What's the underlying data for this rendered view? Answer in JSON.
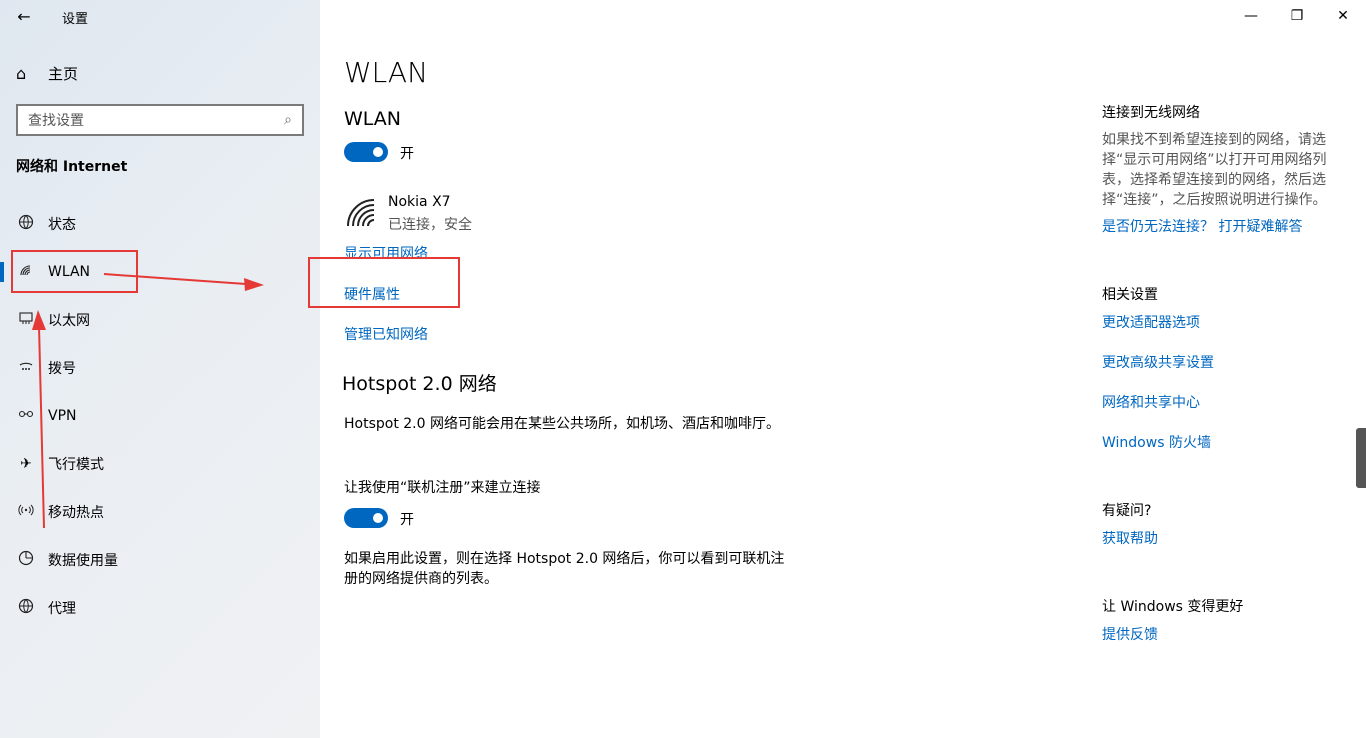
{
  "window": {
    "title": "设置",
    "back_glyph": "←",
    "minimize_glyph": "—",
    "restore_glyph": "❐",
    "close_glyph": "✕"
  },
  "sidebar": {
    "home_label": "主页",
    "search_placeholder": "查找设置",
    "section_title": "网络和 Internet",
    "items": [
      {
        "label": "状态",
        "icon": "globe-status-icon"
      },
      {
        "label": "WLAN",
        "icon": "wifi-icon"
      },
      {
        "label": "以太网",
        "icon": "ethernet-icon"
      },
      {
        "label": "拨号",
        "icon": "dialup-icon"
      },
      {
        "label": "VPN",
        "icon": "vpn-icon"
      },
      {
        "label": "飞行模式",
        "icon": "airplane-icon"
      },
      {
        "label": "移动热点",
        "icon": "hotspot-icon"
      },
      {
        "label": "数据使用量",
        "icon": "data-usage-icon"
      },
      {
        "label": "代理",
        "icon": "globe-icon"
      }
    ],
    "active_index": 1
  },
  "main": {
    "title": "WLAN",
    "wlan_heading": "WLAN",
    "wlan_toggle_label": "开",
    "network_name": "Nokia X7",
    "network_status": "已连接，安全",
    "links": {
      "show_networks": "显示可用网络",
      "hardware_props": "硬件属性",
      "manage_known": "管理已知网络"
    },
    "hotspot_heading": "Hotspot 2.0 网络",
    "hotspot_desc": "Hotspot 2.0 网络可能会用在某些公共场所，如机场、酒店和咖啡厅。",
    "signup_label": "让我使用“联机注册”来建立连接",
    "signup_toggle_label": "开",
    "signup_desc": "如果启用此设置，则在选择 Hotspot 2.0 网络后，你可以看到可联机注册的网络提供商的列表。"
  },
  "right": {
    "connect_heading": "连接到无线网络",
    "connect_text": "如果找不到希望连接到的网络，请选择“显示可用网络”以打开可用网络列表，选择希望连接到的网络，然后选择“连接”，之后按照说明进行操作。",
    "troubleshoot_link": "是否仍无法连接？ 打开疑难解答",
    "related_heading": "相关设置",
    "related_links": [
      "更改适配器选项",
      "更改高级共享设置",
      "网络和共享中心",
      "Windows 防火墙"
    ],
    "question_heading": "有疑问?",
    "help_link": "获取帮助",
    "improve_heading": "让 Windows 变得更好",
    "feedback_link": "提供反馈"
  },
  "colors": {
    "accent": "#0067c0",
    "annotation": "#e53935"
  }
}
